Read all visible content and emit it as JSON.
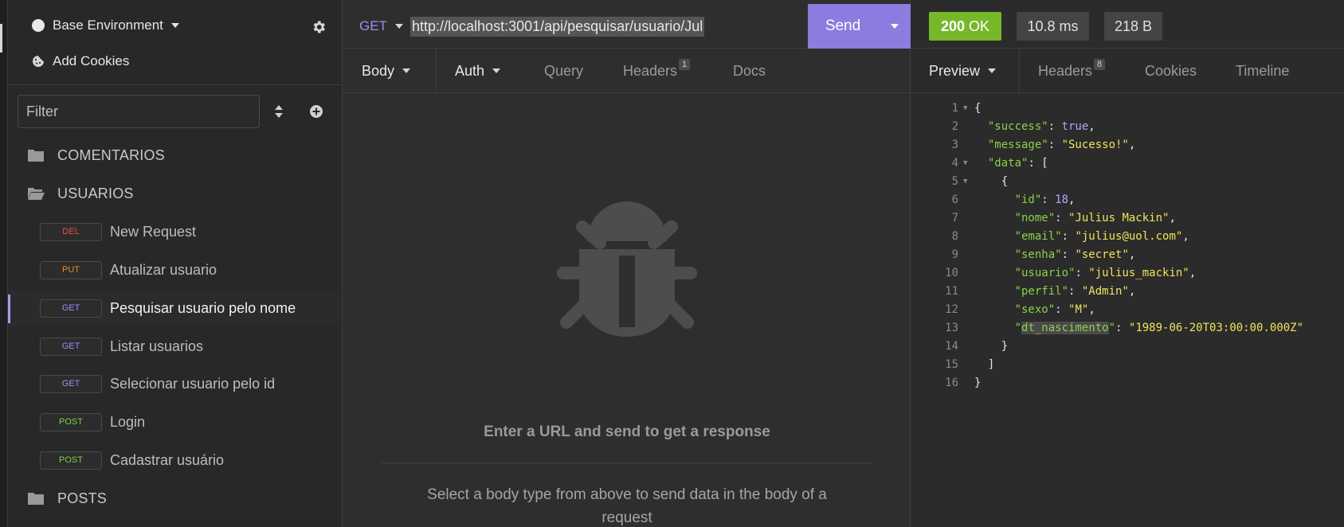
{
  "sidebar": {
    "environment": "Base Environment",
    "cookies": "Add Cookies",
    "filter_placeholder": "Filter",
    "folders": {
      "comentarios": "COMENTARIOS",
      "usuarios": "USUARIOS",
      "posts": "POSTS"
    },
    "requests": [
      {
        "method": "DEL",
        "color": "#e5533d",
        "label": "New Request"
      },
      {
        "method": "PUT",
        "color": "#e88a2f",
        "label": "Atualizar usuario"
      },
      {
        "method": "GET",
        "color": "#9e8df5",
        "label": "Pesquisar usuario pelo nome"
      },
      {
        "method": "GET",
        "color": "#9e8df5",
        "label": "Listar usuarios"
      },
      {
        "method": "GET",
        "color": "#9e8df5",
        "label": "Selecionar usuario pelo id"
      },
      {
        "method": "POST",
        "color": "#7fd14b",
        "label": "Login"
      },
      {
        "method": "POST",
        "color": "#7fd14b",
        "label": "Cadastrar usuário"
      }
    ]
  },
  "request": {
    "method": "GET",
    "url": "http://localhost:3001/api/pesquisar/usuario/Jul",
    "send_label": "Send",
    "tabs": {
      "body": "Body",
      "auth": "Auth",
      "query": "Query",
      "headers": "Headers",
      "headers_count": "1",
      "docs": "Docs"
    },
    "empty_title": "Enter a URL and send to get a response",
    "empty_subtitle": "Select a body type from above to send data in the body of a request"
  },
  "response": {
    "status_code": "200",
    "status_text": "OK",
    "time": "10.8 ms",
    "size": "218 B",
    "tabs": {
      "preview": "Preview",
      "headers": "Headers",
      "headers_count": "8",
      "cookies": "Cookies",
      "timeline": "Timeline"
    },
    "json": {
      "success": "true",
      "message": "\"Sucesso!\"",
      "id": "18",
      "nome": "\"Julius Mackin\"",
      "email": "\"julius@uol.com\"",
      "senha": "\"secret\"",
      "usuario": "\"julius_mackin\"",
      "perfil": "\"Admin\"",
      "sexo": "\"M\"",
      "dt_nascimento": "\"1989-06-20T03:00:00.000Z\""
    }
  },
  "colors": {
    "accent": "#8b7ce0",
    "ok": "#76b82a"
  }
}
